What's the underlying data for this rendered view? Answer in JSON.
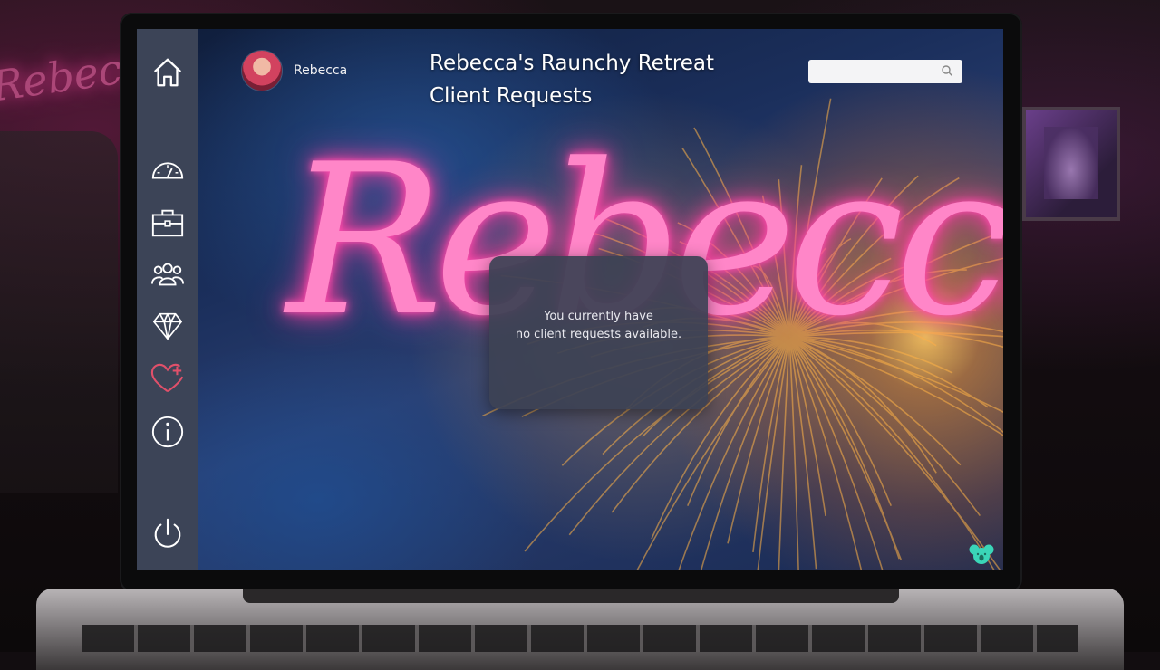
{
  "app": {
    "title_line1": "Rebecca's Raunchy Retreat",
    "title_line2": "Client Requests"
  },
  "user": {
    "name": "Rebecca"
  },
  "search": {
    "value": "",
    "placeholder": ""
  },
  "sidebar": {
    "items": [
      {
        "icon": "home-icon"
      },
      {
        "icon": "speedometer-icon"
      },
      {
        "icon": "briefcase-icon"
      },
      {
        "icon": "users-icon"
      },
      {
        "icon": "diamond-icon"
      },
      {
        "icon": "heart-plus-icon",
        "active_color": "#e0506a"
      },
      {
        "icon": "info-icon"
      },
      {
        "icon": "power-icon"
      }
    ]
  },
  "wallpaper": {
    "neon_text": "Rebecca's"
  },
  "room_sign": {
    "text": "Rebecca"
  },
  "empty_state": {
    "line1": "You currently have",
    "line2": "no client requests available."
  },
  "colors": {
    "sidebar_bg": "#3c4457",
    "modal_bg": "#3c4254",
    "neon_pink": "#ff86c8",
    "accent_red": "#e0506a",
    "koala_teal": "#3ad6b8"
  }
}
